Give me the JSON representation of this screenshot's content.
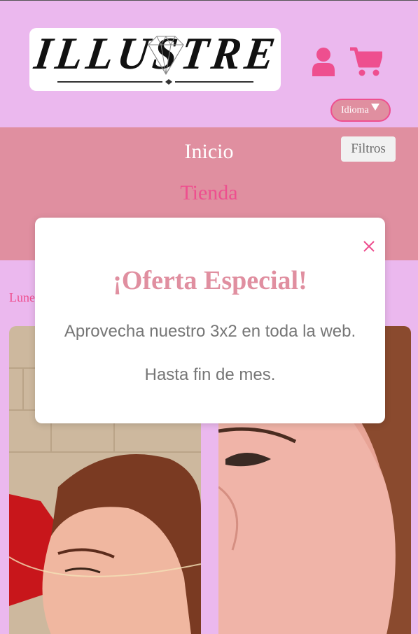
{
  "header": {
    "logo_text": "ILLUSTRE",
    "user_icon": "user-icon",
    "cart_icon": "cart-icon",
    "language_label": "Idioma",
    "colors": {
      "background": "#ebb8ee",
      "accent": "#ee4f8f"
    }
  },
  "nav": {
    "items": [
      {
        "label": "Inicio"
      },
      {
        "label": "Tienda"
      }
    ],
    "filters_label": "Filtros",
    "background": "#e08fa0"
  },
  "content": {
    "date_text": "Lune"
  },
  "modal": {
    "title": "¡Oferta Especial!",
    "line1": "Aprovecha nuestro 3x2 en toda la web.",
    "line2": "Hasta fin de mes.",
    "close_icon": "close-icon"
  }
}
